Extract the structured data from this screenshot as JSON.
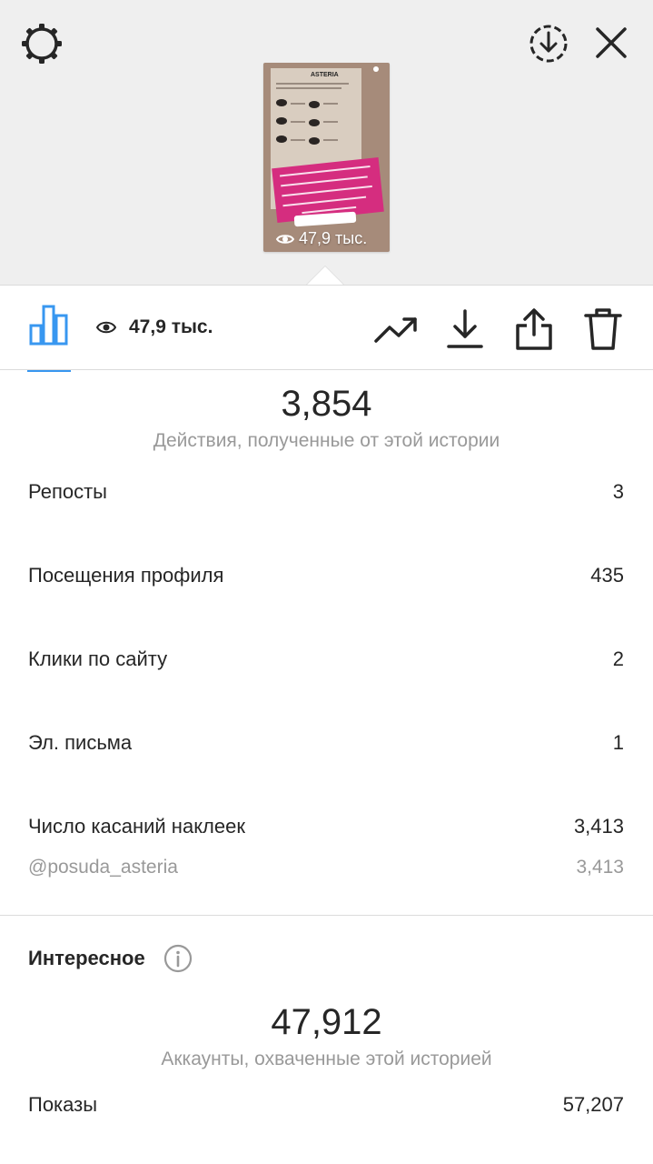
{
  "header": {
    "settings_icon": "settings-gear-icon",
    "download_icon": "download-circle-icon",
    "close_icon": "close-icon"
  },
  "story_preview": {
    "brand": "ASTERIA",
    "views_label": "47,9 тыс.",
    "caption_color": "#d52d7f"
  },
  "tabs": {
    "insights_icon": "bar-chart-icon",
    "views_count": "47,9 тыс.",
    "actions": [
      "trending-up-icon",
      "download-icon",
      "share-icon",
      "trash-icon"
    ]
  },
  "interactions": {
    "total": "3,854",
    "caption": "Действия, полученные от этой истории",
    "rows": [
      {
        "label": "Репосты",
        "value": "3"
      },
      {
        "label": "Посещения профиля",
        "value": "435"
      },
      {
        "label": "Клики по сайту",
        "value": "2"
      },
      {
        "label": "Эл. письма",
        "value": "1"
      },
      {
        "label": "Число касаний наклеек",
        "value": "3,413"
      }
    ],
    "sticker": {
      "label": "@posuda_asteria",
      "value": "3,413"
    }
  },
  "discovery": {
    "title": "Интересное",
    "reach": "47,912",
    "reach_caption": "Аккаунты, охваченные этой историей",
    "rows": [
      {
        "label": "Показы",
        "value": "57,207"
      }
    ]
  },
  "colors": {
    "accent": "#3897f0",
    "text": "#262626",
    "secondary": "#999999",
    "top_background": "#efefef"
  }
}
